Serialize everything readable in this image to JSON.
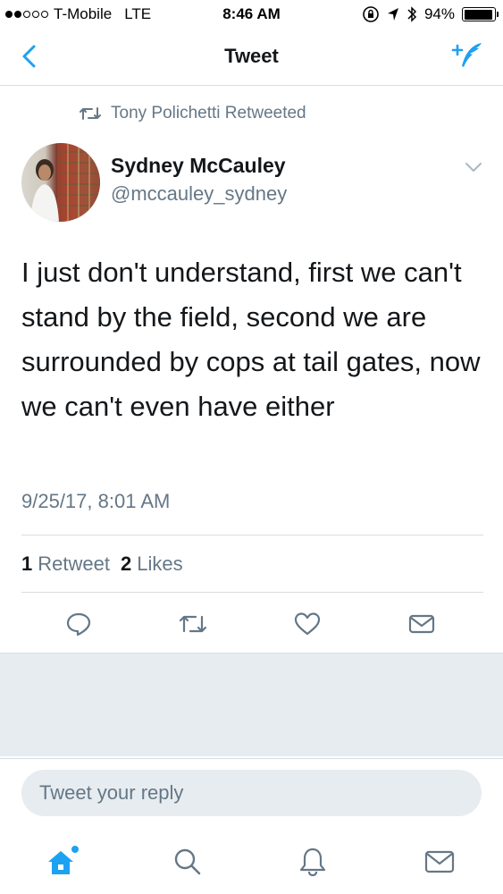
{
  "status_bar": {
    "carrier": "T-Mobile",
    "network": "LTE",
    "time": "8:46 AM",
    "battery_percent": "94%",
    "battery_level": 0.94
  },
  "nav": {
    "title": "Tweet",
    "back_icon": "chevron-left-icon",
    "compose_icon": "compose-tweet-icon"
  },
  "tweet": {
    "retweeted_by": "Tony Polichetti Retweeted",
    "author_name": "Sydney McCauley",
    "author_handle": "@mccauley_sydney",
    "text": "I just don't understand, first we can't stand by the field, second we are surrounded by cops at tail gates, now we can't even have either",
    "timestamp": "9/25/17, 8:01 AM",
    "retweet_count": "1",
    "retweet_label": "Retweet",
    "like_count": "2",
    "like_label": "Likes"
  },
  "reply": {
    "placeholder": "Tweet your reply"
  },
  "tabs": [
    {
      "name": "home-icon"
    },
    {
      "name": "search-icon"
    },
    {
      "name": "notifications-icon"
    },
    {
      "name": "messages-icon"
    }
  ],
  "colors": {
    "accent": "#1da1f2",
    "secondary_text": "#657786",
    "divider": "#d8dde1",
    "background_gray": "#e6ecf0"
  }
}
